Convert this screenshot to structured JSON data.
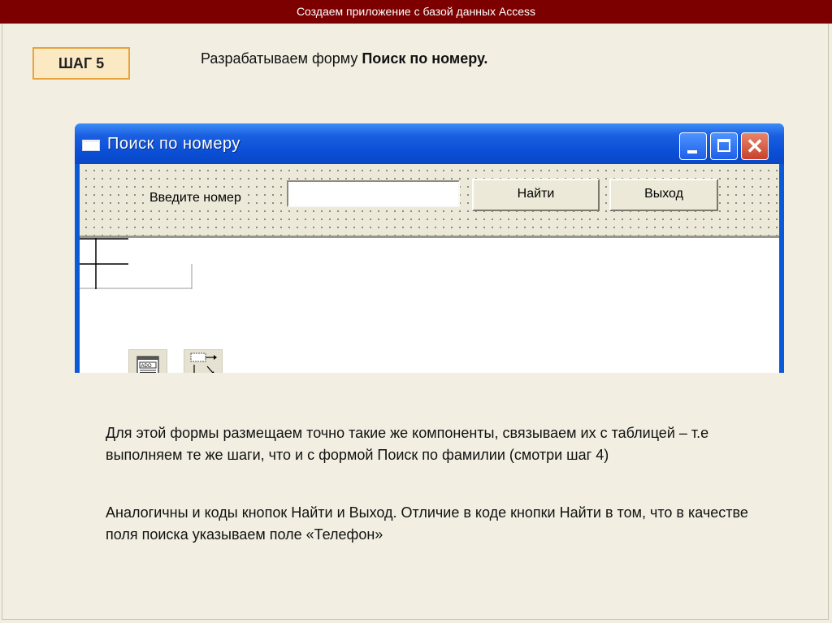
{
  "header": {
    "title": "Создаем приложение с базой данных Access"
  },
  "step": {
    "label": "ШАГ 5"
  },
  "heading": {
    "prefix": "Разрабатываем форму ",
    "bold": "Поиск по номеру."
  },
  "window": {
    "title": "Поиск по номеру",
    "close_glyph": "✕",
    "label": "Введите номер",
    "input_value": "",
    "find_button": "Найти",
    "exit_button": "Выход",
    "components": [
      {
        "name": "ado-connection",
        "icon": "ado-icon"
      },
      {
        "name": "data-source",
        "icon": "datasource-icon"
      }
    ]
  },
  "body": {
    "paragraph1": "Для этой формы размещаем точно такие же компоненты, связываем их с таблицей – т.е выполняем те же шаги, что и с формой Поиск по фамилии (смотри шаг 4)",
    "paragraph2": "Аналогичны и коды кнопок Найти и Выход. Отличие в коде кнопки Найти в том, что в качестве поля поиска указываем поле «Телефон»"
  },
  "colors": {
    "header": "#7d0000",
    "step_border": "#e8a33a",
    "step_fill": "#fbe9c4",
    "xp_blue": "#0a59d8",
    "window_face": "#ece9d8"
  }
}
